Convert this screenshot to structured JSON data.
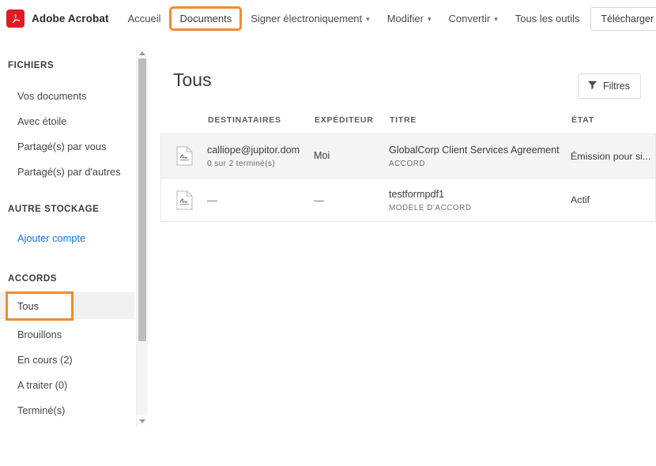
{
  "header": {
    "brand": "Adobe Acrobat",
    "logo_icon": "adobe-acrobat-logo",
    "nav": [
      {
        "label": "Accueil",
        "has_chevron": false,
        "highlighted": false
      },
      {
        "label": "Documents",
        "has_chevron": false,
        "highlighted": true
      },
      {
        "label": "Signer électroniquement",
        "has_chevron": true,
        "highlighted": false
      },
      {
        "label": "Modifier",
        "has_chevron": true,
        "highlighted": false
      },
      {
        "label": "Convertir",
        "has_chevron": true,
        "highlighted": false
      },
      {
        "label": "Tous les outils",
        "has_chevron": false,
        "highlighted": false
      }
    ],
    "download_button": "Télécharger l'applic...",
    "search_icon": "search-icon",
    "highlight_color": "#F28B30"
  },
  "sidebar": {
    "groups": [
      {
        "title": "FICHIERS",
        "items": [
          {
            "label": "Vos documents",
            "style": "normal"
          },
          {
            "label": "Avec étoile",
            "style": "normal"
          },
          {
            "label": "Partagé(s) par vous",
            "style": "normal"
          },
          {
            "label": "Partagé(s) par d'autres",
            "style": "normal"
          }
        ]
      },
      {
        "title": "AUTRE STOCKAGE",
        "items": [
          {
            "label": "Ajouter compte",
            "style": "link"
          }
        ]
      },
      {
        "title": "ACCORDS",
        "items": [
          {
            "label": "Tous",
            "style": "selected"
          },
          {
            "label": "Brouillons",
            "style": "normal"
          },
          {
            "label": "En cours (2)",
            "style": "normal"
          },
          {
            "label": "A traiter (0)",
            "style": "normal"
          },
          {
            "label": "Terminé(s)",
            "style": "normal"
          }
        ]
      }
    ],
    "link_color": "#1473E6"
  },
  "main": {
    "title": "Tous",
    "filters_button": "Filtres",
    "filters_icon": "funnel-icon",
    "columns": [
      "DESTINATAIRES",
      "EXPÉDITEUR",
      "TITRE",
      "ÉTAT"
    ],
    "rows": [
      {
        "icon": "signed-document-icon",
        "recipient": "calliope@jupitor.dom",
        "recipient_sub": "0 sur 2 terminé(s)",
        "sender": "Moi",
        "title": "GlobalCorp Client Services Agreement",
        "title_sub": "ACCORD",
        "state": "Émission pour si...",
        "shaded": true
      },
      {
        "icon": "signed-document-icon",
        "recipient": "—",
        "recipient_sub": "",
        "sender": "—",
        "title": "testformpdf1",
        "title_sub": "MODÈLE D'ACCORD",
        "state": "Actif",
        "shaded": false
      }
    ]
  }
}
